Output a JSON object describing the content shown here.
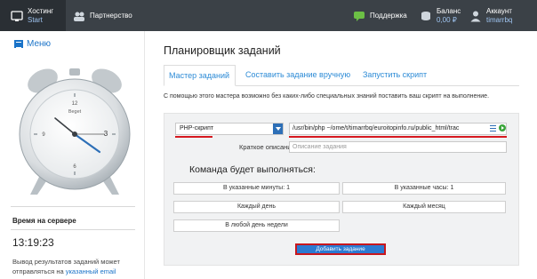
{
  "topbar": {
    "hosting": {
      "line1": "Хостинг",
      "line2": "Start"
    },
    "partners": {
      "label": "Партнерство"
    },
    "support": {
      "label": "Поддержка"
    },
    "balance": {
      "line1": "Баланс",
      "line2": "0,00 ₽"
    },
    "account": {
      "line1": "Аккаунт",
      "line2": "timarrbq"
    }
  },
  "sidebar": {
    "menu_label": "Меню",
    "clock_brand": "Beget",
    "clock_numerals": {
      "n12": "12",
      "n3": "3",
      "n6": "6",
      "n9": "9"
    },
    "server_time_title": "Время на сервере",
    "server_time": "13:19:23",
    "note_prefix": "Вывод результатов заданий может отправляться на ",
    "note_link": "указанный email"
  },
  "main": {
    "title": "Планировщик заданий",
    "tabs": [
      {
        "label": "Мастер заданий"
      },
      {
        "label": "Составить задание вручную"
      },
      {
        "label": "Запустить скрипт"
      }
    ],
    "intro": "С помощью этого мастера возможно без каких-либо специальных знаний поставить ваш скрипт на выполнение.",
    "form": {
      "script_type": "PHP-скрипт",
      "script_path": "/usr/bin/php ~/ome/t/timarrbq/euroitopinfo.ru/public_html/trac",
      "desc_label": "Краткое описание:",
      "desc_placeholder": "Описание задания",
      "command_title": "Команда будет выполняться:",
      "options": [
        "В указанные минуты: 1",
        "В указанные часы: 1",
        "Каждый день",
        "Каждый месяц",
        "В любой день недели"
      ],
      "submit_label": "Добавить задание"
    }
  },
  "colors": {
    "topbar_bg": "#3b4147",
    "accent": "#2d8bd6",
    "highlight": "#d71920",
    "button": "#2c7ad1"
  }
}
